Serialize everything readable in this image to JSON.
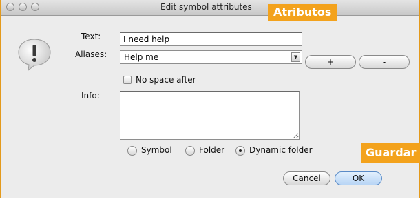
{
  "window": {
    "title": "Edit symbol attributes"
  },
  "callouts": {
    "top": "Atributos",
    "bottom": "Guardar"
  },
  "form": {
    "text_label": "Text:",
    "text_value": "I need help",
    "aliases_label": "Aliases:",
    "aliases_value": "Help me",
    "add_alias_label": "+",
    "remove_alias_label": "-",
    "no_space_label": "No space after",
    "no_space_checked": false,
    "info_label": "Info:",
    "info_value": ""
  },
  "type_options": [
    {
      "label": "Symbol",
      "selected": false
    },
    {
      "label": "Folder",
      "selected": false
    },
    {
      "label": "Dynamic folder",
      "selected": true
    }
  ],
  "buttons": {
    "cancel": "Cancel",
    "ok": "OK"
  },
  "icons": {
    "dialog_icon": "speech-bubble-exclamation-icon",
    "dropdown": "dropdown-arrow-icon"
  },
  "colors": {
    "callout": "#f3a21c",
    "default_button": "#b8d5f5"
  }
}
